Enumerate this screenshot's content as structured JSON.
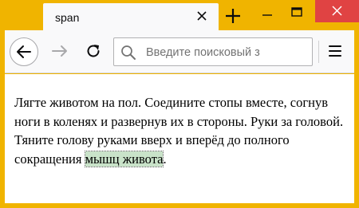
{
  "tab": {
    "title": "span"
  },
  "toolbar": {
    "search_placeholder": "Введите поисковый з"
  },
  "content": {
    "text_before": "Лягте животом на пол. Соедините стопы вместе, согнув ноги в коленях и развернув их в стороны. Руки за головой. Тяните голову руками вверх и вперёд до полного сокращения ",
    "highlighted": "мышц живота",
    "text_after": "."
  },
  "colors": {
    "frame": "#f0b400",
    "close_button": "#e04343",
    "highlight": "#c9e3c9"
  },
  "icons": [
    "close-icon",
    "plus-icon",
    "minimize-icon",
    "maximize-icon",
    "back-arrow-icon",
    "forward-arrow-icon",
    "reload-icon",
    "search-icon",
    "hamburger-menu-icon"
  ]
}
